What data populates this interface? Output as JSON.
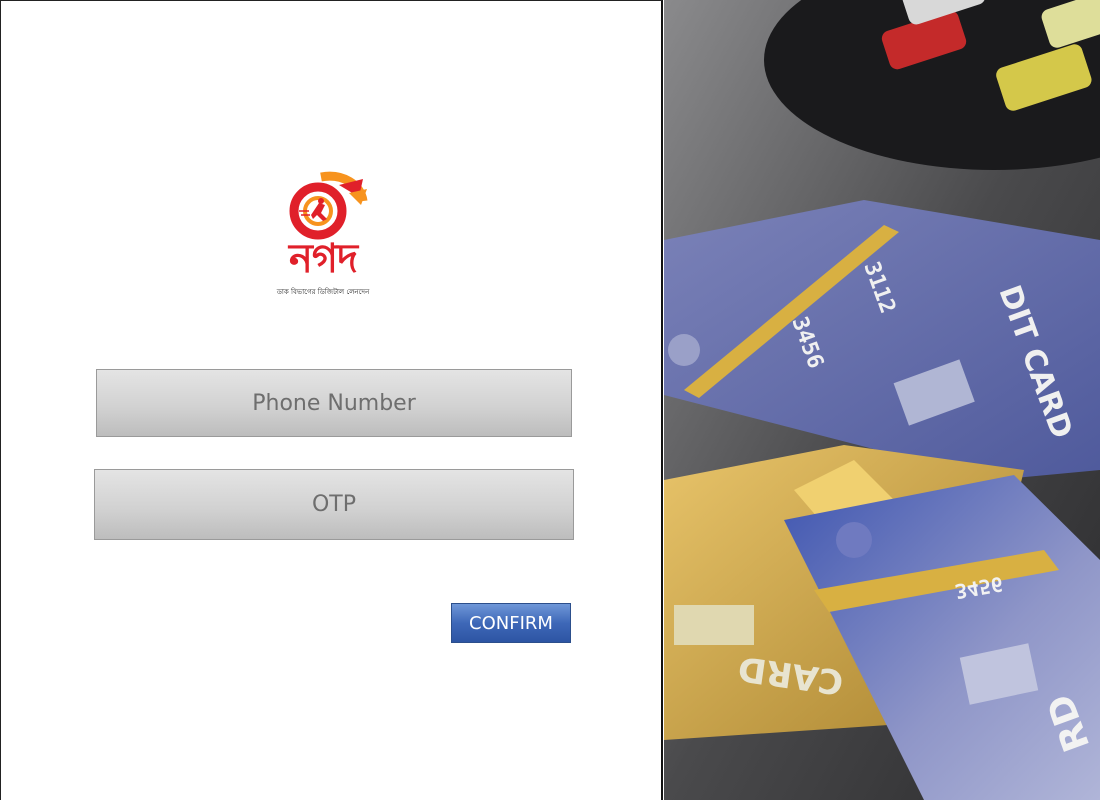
{
  "logo": {
    "wordmark": "নগদ",
    "tagline": "ডাক বিভাগের ডিজিটাল লেনদেন",
    "colors": {
      "red": "#e0202a",
      "orange": "#f7931e"
    }
  },
  "form": {
    "phone_placeholder": "Phone Number",
    "otp_placeholder": "OTP",
    "confirm_label": "CONFIRM"
  },
  "photo": {
    "card_texts": [
      "3112",
      "3456",
      "DIT CARD",
      "3456",
      "3456",
      "CARD",
      "RD"
    ]
  },
  "colors": {
    "button_blue": "#3e68b8",
    "field_gray": "#d2d2d2"
  }
}
